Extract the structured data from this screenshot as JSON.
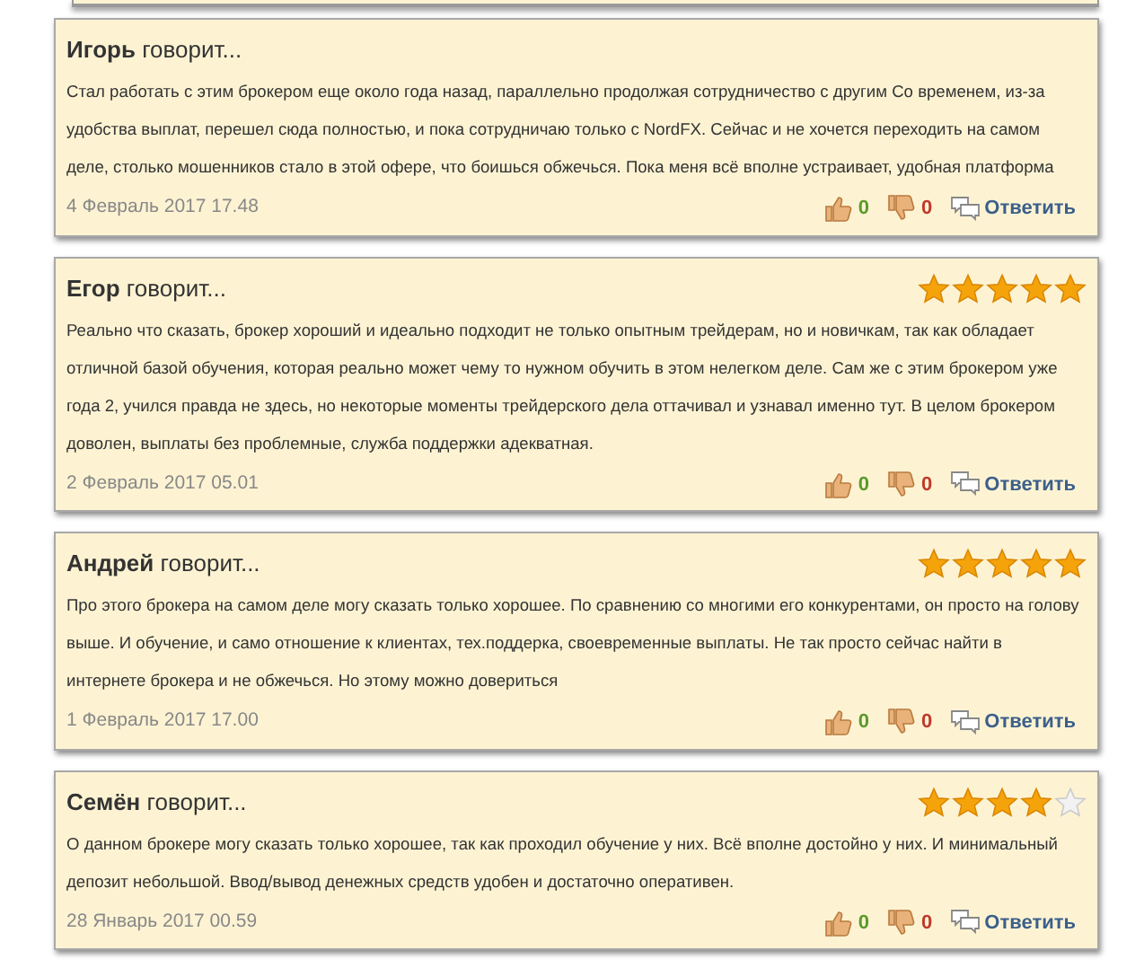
{
  "comments": [
    {
      "author": "Игорь",
      "verb": "говорит...",
      "text": "Стал работать с этим брокером еще около года назад, параллельно продолжая сотрудничество с другим Со временем, из-за удобства выплат, перешел сюда полностью, и пока сотрудничаю только с NordFX. Сейчас и не хочется переходить на самом деле, столько мошенников стало в этой офере, что боишься обжечься. Пока меня всё вполне устраивает, удобная платформа",
      "date": "4 Февраль 2017 17.48",
      "likes": "0",
      "dislikes": "0",
      "reply": "Ответить"
    },
    {
      "author": "Егор",
      "verb": "говорит...",
      "stars": 5,
      "text": "Реально что сказать, брокер хороший и идеально подходит не только опытным трейдерам, но и новичкам, так как обладает отличной базой обучения, которая реально может чему то нужном обучить в этом нелегком деле. Сам же с этим брокером уже года 2, учился правда не здесь, но некоторые моменты трейдерского дела оттачивал и узнавал именно тут. В целом брокером доволен, выплаты без проблемные, служба поддержки адекватная.",
      "date": "2 Февраль 2017 05.01",
      "likes": "0",
      "dislikes": "0",
      "reply": "Ответить"
    },
    {
      "author": "Андрей",
      "verb": "говорит...",
      "stars": 5,
      "text": "Про этого брокера на самом деле могу сказать только хорошее. По сравнению со многими его конкурентами, он просто на голову выше. И обучение, и само отношение к клиентах, тех.поддерка, своевременные выплаты. Не так просто сейчас найти в интернете брокера и не обжечься. Но этому можно довериться",
      "date": "1 Февраль 2017 17.00",
      "likes": "0",
      "dislikes": "0",
      "reply": "Ответить"
    },
    {
      "author": "Семён",
      "verb": "говорит...",
      "stars": 4,
      "text": "О данном брокере могу сказать только хорошее, так как проходил обучение у них. Всё вполне достойно у них. И минимальный депозит небольшой. Ввод/вывод денежных средств удобен и достаточно оперативен.",
      "date": "28 Январь 2017 00.59",
      "likes": "0",
      "dislikes": "0",
      "reply": "Ответить"
    }
  ]
}
